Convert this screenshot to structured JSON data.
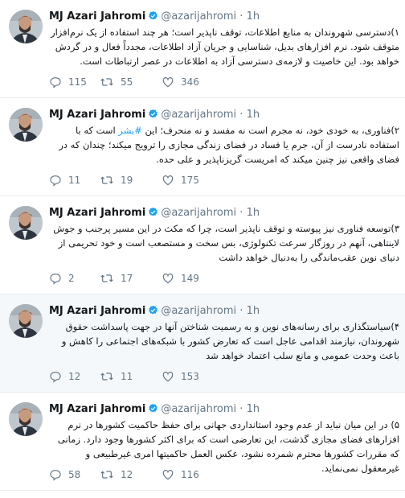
{
  "author": {
    "name": "MJ Azari Jahromi",
    "handle": "@azarijahromi",
    "dot": "·",
    "time": "1h"
  },
  "colors": {
    "verified": "#1da1f2",
    "icon": "#657786",
    "link": "#1da1f2"
  },
  "icons": [
    "reply-icon",
    "retweet-icon",
    "like-icon",
    "verified-badge-icon"
  ],
  "tweets": [
    {
      "text": "۱)دسترسی شهروندان به منابع اطلاعات، توقف ناپذیر است؛ هر چند استفاده از یک نرم‌افزار متوقف شود. نرم افزارهای بدیل، شناسایی و جریان آزاد اطلاعات، مجدداً فعال و در گردش خواهد بود. این خاصیت و لازمه‌ی دسترسی آزاد به اطلاعات در عصر ارتباطات است.",
      "replies": "115",
      "retweets": "55",
      "likes": "346"
    },
    {
      "text_pre": "۲)فناوری، به خودی خود، نه مجرم است نه مفسد و نه منحرف؛ این ",
      "hashtag": "#بشر",
      "text_post": " است که با استفاده نادرست از آن، جرم یا فساد در فضای زندگی مجازی را ترویج میکند؛ چندان که در فضای واقعی نیز چنین میکند که امریست گریزناپذیر و علی حده.",
      "replies": "11",
      "retweets": "19",
      "likes": "175"
    },
    {
      "text": "۳)توسعه فناوری نیز پیوسته و توقف ناپذیر است، چرا که مکث در این مسیر پرجنب و جوش لاینتاهی، آنهم در روزگار سرعت تکنولوژی، بس سخت و مستصعب است و خود تحریمی از دنیای نوین عقب‌ماندگی را به‌دنبال خواهد داشت",
      "replies": "2",
      "retweets": "17",
      "likes": "149"
    },
    {
      "text": "۴)سیاستگذاری برای رسانه‌های نوین و به رسمیت شناختن آنها در جهت پاسداشت حقوق شهروندان، نیازمند اقدامی عاجل است که تعارض کشور با شبکه‌های اجتماعی را کاهش و باعث وحدت عمومی و مانع سلب اعتماد خواهد شد",
      "replies": "12",
      "retweets": "11",
      "likes": "153"
    },
    {
      "text": "۵) در این میان نباید از عدم وجود استانداردی جهانی برای حفظ حاکمیت کشورها در نرم افزارهای فضای مجازی گذشت، این تعارضی است که برای اکثر کشورها وجود دارد. زمانی که مقررات کشورها محترم شمرده نشود، عکس العمل حاکمیتها امری غیرطبیعی و غیرمعقول نمی‌نماید.",
      "replies": "58",
      "retweets": "12",
      "likes": "116"
    }
  ]
}
